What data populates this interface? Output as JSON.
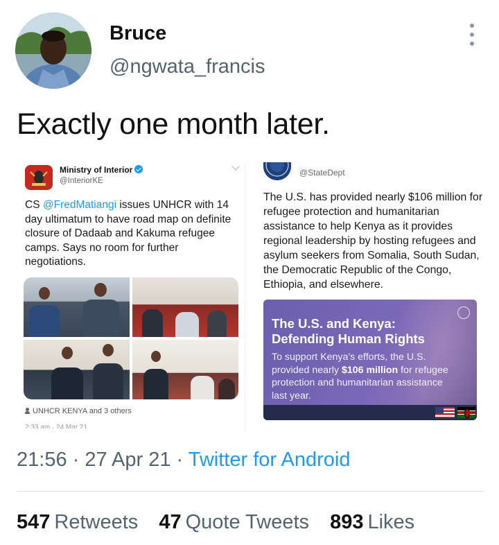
{
  "author": {
    "name": "Bruce",
    "handle": "@ngwata_francis"
  },
  "tweet": {
    "text": "Exactly one month later.",
    "timestamp": "21:56 · 27 Apr 21 · ",
    "source": "Twitter for Android"
  },
  "quoted_left": {
    "account_name": "Ministry of Interior",
    "handle": "@InteriorKE",
    "text_prefix": "CS ",
    "mention": "@FredMatiangi",
    "text_rest": " issues UNHCR with 14 day ultimatum to have road map on definite closure of Dadaab and Kakuma refugee camps. Says no room for further negotiations.",
    "tagged": "UNHCR KENYA and 3 others",
    "cut_off_date": "2:33 am · 24 Mar 21"
  },
  "quoted_right": {
    "handle": "@StateDept",
    "text": "The U.S. has provided nearly $106 million for refugee protection and humanitarian assistance to help Kenya as it provides regional leadership by hosting refugees and asylum seekers from Somalia, South Sudan, the Democratic Republic of the Congo, Ethiopia, and elsewhere.",
    "graphic": {
      "title": "The U.S. and Kenya: Defending Human Rights",
      "body_before": "To support Kenya's efforts, the U.S. provided nearly ",
      "body_bold": "$106 million",
      "body_after": " for refugee protection and humanitarian assistance last year."
    }
  },
  "stats": {
    "retweets_count": "547",
    "retweets_label": "Retweets",
    "quotes_count": "47",
    "quotes_label": "Quote Tweets",
    "likes_count": "893",
    "likes_label": "Likes"
  },
  "colors": {
    "link": "#1d9bf0",
    "secondary_text": "#536471",
    "graphic_purple": "#7b69b8"
  },
  "icons": [
    "more-vertical-icon",
    "verified-icon",
    "chevron-down-icon",
    "person-icon",
    "seal-icon",
    "us-flag-icon",
    "kenya-flag-icon"
  ]
}
